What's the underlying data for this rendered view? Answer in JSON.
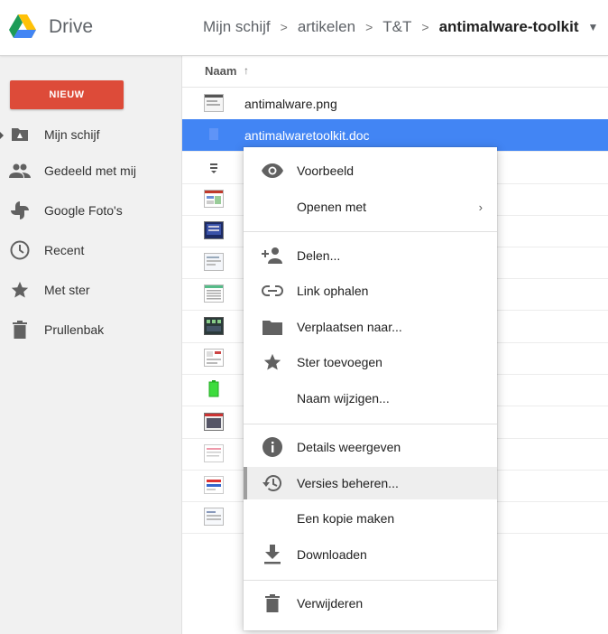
{
  "header": {
    "app_title": "Drive",
    "breadcrumb": [
      "Mijn schijf",
      "artikelen",
      "T&T",
      "antimalware-toolkit"
    ],
    "separator": ">",
    "caret": "▼"
  },
  "sidebar": {
    "new_label": "NIEUW",
    "items": [
      {
        "label": "Mijn schijf",
        "icon": "drive-folder-icon"
      },
      {
        "label": "Gedeeld met mij",
        "icon": "people-icon"
      },
      {
        "label": "Google Foto's",
        "icon": "pinwheel-icon"
      },
      {
        "label": "Recent",
        "icon": "clock-icon"
      },
      {
        "label": "Met ster",
        "icon": "star-icon"
      },
      {
        "label": "Prullenbak",
        "icon": "trash-icon"
      }
    ]
  },
  "list": {
    "column_name": "Naam",
    "sort_indicator": "↑",
    "files": [
      {
        "name": "antimalware.png"
      },
      {
        "name": "antimalwaretoolkit.doc",
        "selected": true
      }
    ]
  },
  "context_menu": {
    "items": [
      {
        "label": "Voorbeeld",
        "icon": "eye-icon"
      },
      {
        "label": "Openen met",
        "icon": "",
        "submenu": "›"
      },
      {
        "label": "Delen...",
        "icon": "add-person-icon"
      },
      {
        "label": "Link ophalen",
        "icon": "link-icon"
      },
      {
        "label": "Verplaatsen naar...",
        "icon": "folder-icon"
      },
      {
        "label": "Ster toevoegen",
        "icon": "star-icon"
      },
      {
        "label": "Naam wijzigen...",
        "icon": ""
      },
      {
        "label": "Details weergeven",
        "icon": "info-icon"
      },
      {
        "label": "Versies beheren...",
        "icon": "history-icon",
        "hovered": true
      },
      {
        "label": "Een kopie maken",
        "icon": ""
      },
      {
        "label": "Downloaden",
        "icon": "download-icon"
      },
      {
        "label": "Verwijderen",
        "icon": "trash-icon"
      }
    ]
  },
  "colors": {
    "new_button": "#dd4b39",
    "selected_row": "#4285f4",
    "icon_grey": "#616161"
  }
}
